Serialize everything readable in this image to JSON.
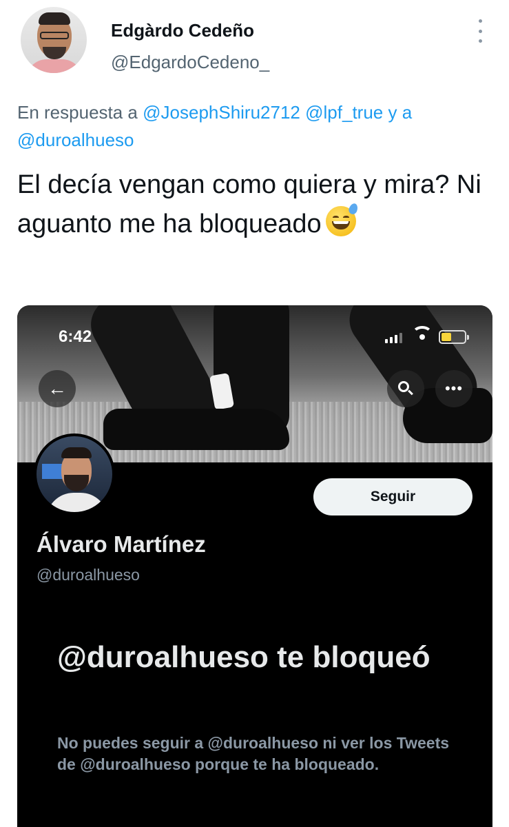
{
  "author": {
    "name": "Edgàrdo Cedeño",
    "handle": "@EdgardoCedeno_"
  },
  "reply": {
    "prefix": "En respuesta a ",
    "mention1": "@JosephShiru2712",
    "mention2": "@lpf_true",
    "connector": " y a",
    "mention3": "@duroalhueso"
  },
  "tweet": {
    "text": "El decía vengan como quiera y mira? Ni aguanto me ha bloqueado",
    "emoji": "grinning-face-with-sweat"
  },
  "embedded_screenshot": {
    "status_bar": {
      "time": "6:42"
    },
    "profile": {
      "display_name": "Álvaro Martínez",
      "handle": "@duroalhueso",
      "follow_label": "Seguir"
    },
    "blocked_notice": {
      "title": "@duroalhueso te bloqueó",
      "description": "No puedes seguir a @duroalhueso ni ver los Tweets de @duroalhueso porque te ha bloqueado."
    }
  },
  "colors": {
    "link": "#1d9bf0",
    "secondary_text": "#536471",
    "dark_bg": "#000000",
    "follow_button_bg": "#eff3f4"
  }
}
